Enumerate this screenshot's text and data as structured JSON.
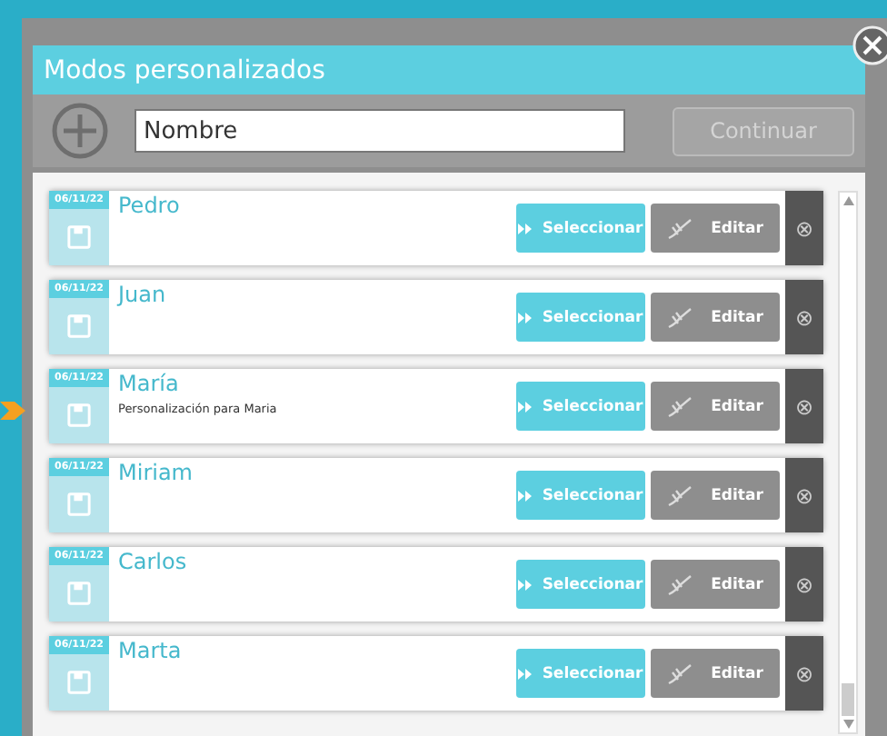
{
  "dialog": {
    "title": "Modos personalizados"
  },
  "toolbar": {
    "placeholder": "Nombre",
    "continue": {
      "label": "Continuar",
      "disabled": true
    }
  },
  "items": [
    {
      "date": "06/11/22",
      "name": "Pedro",
      "select": "Seleccionar",
      "edit": "Editar",
      "delete": "⊗"
    },
    {
      "date": "06/11/22",
      "name": "Juan",
      "select": "Seleccionar",
      "edit": "Editar",
      "delete": "⊗"
    },
    {
      "date": "06/11/22",
      "name": "María",
      "description": "Personalización para Maria",
      "select": "Seleccionar",
      "edit": "Editar",
      "delete": "⊗"
    },
    {
      "date": "06/11/22",
      "name": "Miriam",
      "select": "Seleccionar",
      "edit": "Editar",
      "delete": "⊗"
    },
    {
      "date": "06/11/22",
      "name": "Carlos",
      "select": "Seleccionar",
      "edit": "Editar",
      "delete": "⊗"
    },
    {
      "date": "06/11/22",
      "name": "Marta",
      "select": "Seleccionar",
      "edit": "Editar",
      "delete": "⊗"
    }
  ]
}
